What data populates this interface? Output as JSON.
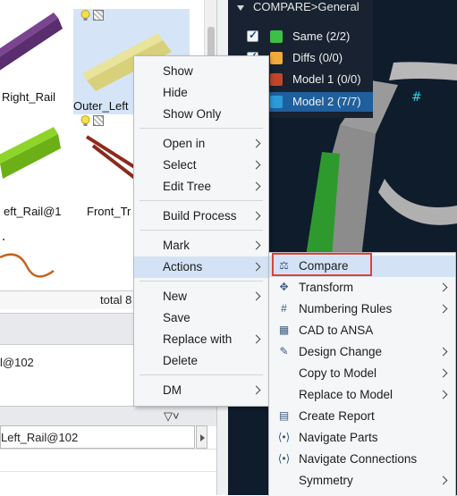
{
  "thumbnails": [
    {
      "caption": "Right_Rail",
      "selected": false,
      "flags": false,
      "color": "#5a2d6e"
    },
    {
      "caption": "Outer_Left",
      "selected": true,
      "flags": true,
      "color": "#d8d07a"
    },
    {
      "caption": "eft_Rail@1",
      "selected": false,
      "flags": false,
      "color": "#7cc31a"
    },
    {
      "caption": "Front_Tr",
      "selected": false,
      "flags": true,
      "color": "#8b2a1c"
    }
  ],
  "list_footer_total": "total 8",
  "info_line": "l@102",
  "field_value": "Left_Rail@102",
  "filter_icon": "▽˅",
  "compare_panel": {
    "title": "COMPARE>General",
    "items": [
      {
        "label": "Same (2/2)",
        "color": "#3cc046",
        "checked": true
      },
      {
        "label": "Diffs (0/0)",
        "color": "#f0a93a",
        "checked": true
      },
      {
        "label": "Model 1 (0/0)",
        "color": "#c0452a",
        "checked": false
      },
      {
        "label": "Model 2 (7/7)",
        "color": "#2a9ad8",
        "checked": false
      }
    ]
  },
  "context_menu": [
    {
      "label": "Show",
      "submenu": false
    },
    {
      "label": "Hide",
      "submenu": false
    },
    {
      "label": "Show Only",
      "submenu": false
    },
    {
      "label": "Open in",
      "submenu": true
    },
    {
      "label": "Select",
      "submenu": true
    },
    {
      "label": "Edit Tree",
      "submenu": true
    },
    {
      "label": "Build Process",
      "submenu": true
    },
    {
      "label": "Mark",
      "submenu": true
    },
    {
      "label": "Actions",
      "submenu": true
    },
    {
      "label": "New",
      "submenu": true
    },
    {
      "label": "Save",
      "submenu": false
    },
    {
      "label": "Replace with",
      "submenu": true
    },
    {
      "label": "Delete",
      "submenu": false
    },
    {
      "label": "DM",
      "submenu": true
    }
  ],
  "actions_submenu": [
    {
      "label": "Compare",
      "icon": "compare-icon",
      "submenu": false
    },
    {
      "label": "Transform",
      "icon": "transform-icon",
      "submenu": true
    },
    {
      "label": "Numbering Rules",
      "icon": "numbering-icon",
      "submenu": true
    },
    {
      "label": "CAD to ANSA",
      "icon": "cad-icon",
      "submenu": false
    },
    {
      "label": "Design Change",
      "icon": "design-change-icon",
      "submenu": true
    },
    {
      "label": "Copy to Model",
      "icon": "",
      "submenu": true
    },
    {
      "label": "Replace to Model",
      "icon": "",
      "submenu": true
    },
    {
      "label": "Create Report",
      "icon": "report-icon",
      "submenu": false
    },
    {
      "label": "Navigate Parts",
      "icon": "navigate-icon",
      "submenu": false
    },
    {
      "label": "Navigate Connections",
      "icon": "navigate-icon",
      "submenu": false
    },
    {
      "label": "Symmetry",
      "icon": "",
      "submenu": true
    }
  ]
}
